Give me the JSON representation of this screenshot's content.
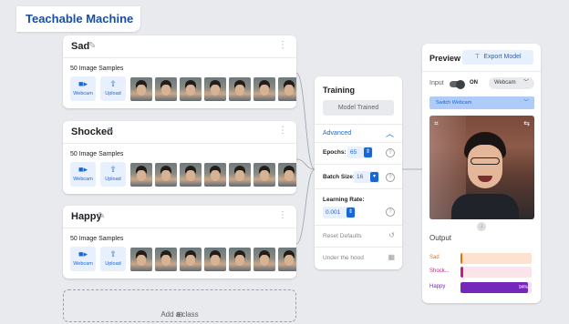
{
  "app": {
    "title": "Teachable Machine"
  },
  "classes": [
    {
      "name": "Sad",
      "samples_label": "50 Image Samples",
      "webcam_label": "Webcam",
      "upload_label": "Upload"
    },
    {
      "name": "Shocked",
      "samples_label": "50 Image Samples",
      "webcam_label": "Webcam",
      "upload_label": "Upload"
    },
    {
      "name": "Happy",
      "samples_label": "50 Image Samples",
      "webcam_label": "Webcam",
      "upload_label": "Upload"
    }
  ],
  "add_class_label": "Add a class",
  "training": {
    "title": "Training",
    "model_trained_label": "Model Trained",
    "advanced_label": "Advanced",
    "epochs_label": "Epochs:",
    "epochs_value": "65",
    "batch_size_label": "Batch Size:",
    "batch_size_value": "16",
    "learning_rate_label": "Learning Rate:",
    "learning_rate_value": "0.001",
    "reset_defaults_label": "Reset Defaults",
    "under_the_hood_label": "Under the hood"
  },
  "preview": {
    "title": "Preview",
    "export_label": "Export Model",
    "input_label": "Input",
    "on_label": "ON",
    "camera_select": "Webcam",
    "switch_webcam_label": "Switch Webcam",
    "output_label": "Output",
    "outputs": [
      {
        "label": "Sad",
        "fraction": 0.01,
        "color": "#e8710a",
        "track": "#fde3cf"
      },
      {
        "label": "Shock...",
        "fraction": 0.04,
        "color": "#d01884",
        "track": "#fce4ec"
      },
      {
        "label": "Happy",
        "fraction": 0.95,
        "color": "#7627bb",
        "track": "#ede3f7",
        "pct_text": "94%"
      }
    ]
  },
  "colors": {
    "accent": "#1967d2",
    "accent_light": "#e8f0fe",
    "brand": "#174ea6"
  },
  "icons": {
    "webcam": "videocam-icon",
    "upload": "upload-icon",
    "edit": "pencil-icon",
    "more": "kebab-icon",
    "help": "help-icon",
    "reset": "reset-icon",
    "hood": "chart-icon",
    "export": "export-icon",
    "add": "add-box-icon"
  }
}
